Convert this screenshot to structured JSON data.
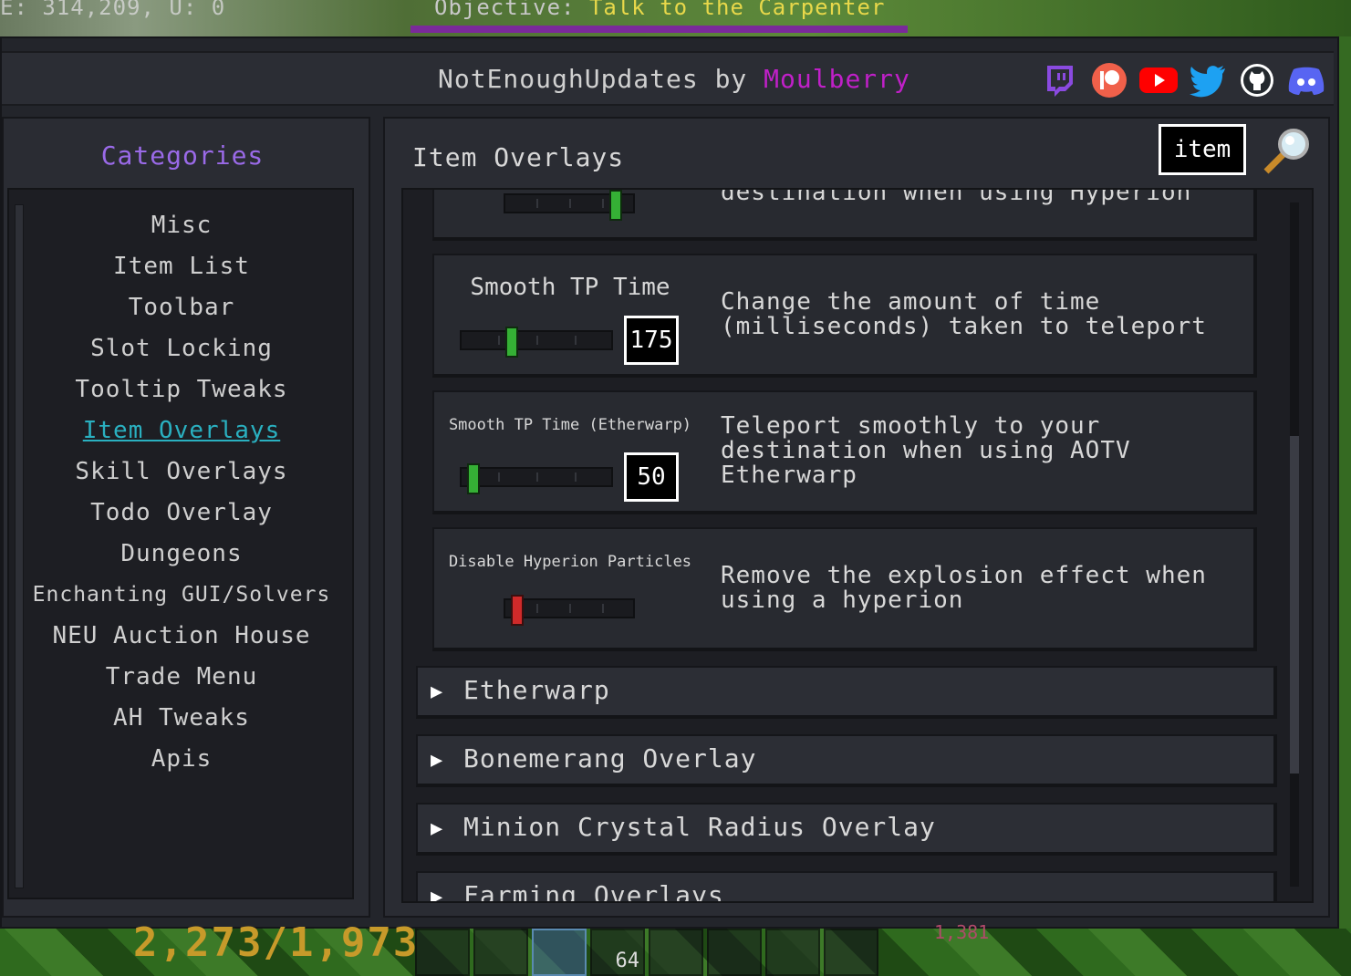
{
  "hud": {
    "coords": "E: 314,209, U: 0",
    "objective_label": "Objective:",
    "objective_value": "Talk to the Carpenter",
    "xp_text": "2,273/1,973",
    "other_text": "1,381",
    "hotbar_count": "64"
  },
  "window": {
    "title_prefix": "NotEnoughUpdates by ",
    "title_author": "Moulberry",
    "socials": [
      "twitch-icon",
      "patreon-icon",
      "youtube-icon",
      "twitter-icon",
      "github-icon",
      "discord-icon"
    ]
  },
  "sidebar": {
    "header": "Categories",
    "items": [
      {
        "label": "Misc"
      },
      {
        "label": "Item List"
      },
      {
        "label": "Toolbar"
      },
      {
        "label": "Slot Locking"
      },
      {
        "label": "Tooltip Tweaks"
      },
      {
        "label": "Item Overlays"
      },
      {
        "label": "Skill Overlays"
      },
      {
        "label": "Todo Overlay"
      },
      {
        "label": "Dungeons"
      },
      {
        "label": "Enchanting GUI/Solvers"
      },
      {
        "label": "NEU Auction House"
      },
      {
        "label": "Trade Menu"
      },
      {
        "label": "AH Tweaks"
      },
      {
        "label": "Apis"
      }
    ],
    "active_item": "Item Overlays"
  },
  "main": {
    "section_title": "Item Overlays",
    "search_value": "item",
    "cut_desc": "destination when using Hyperion",
    "options": [
      {
        "name": "Smooth TP Time",
        "value": "175",
        "description": "Change the amount of time\n(milliseconds) taken to teleport"
      },
      {
        "name": "Smooth TP Time (Etherwarp)",
        "value": "50",
        "description": "Teleport smoothly to your\ndestination when using AOTV\nEtherwarp"
      },
      {
        "name": "Disable Hyperion Particles",
        "toggle": false,
        "description": "Remove the explosion effect when\nusing a hyperion"
      }
    ],
    "accordions": [
      {
        "label": "Etherwarp"
      },
      {
        "label": "Bonemerang Overlay"
      },
      {
        "label": "Minion Crystal Radius Overlay"
      },
      {
        "label": "Farming Overlays"
      }
    ]
  },
  "colors": {
    "author": "#c020c8",
    "categories_header": "#9a6ae8",
    "active_category": "#2ab0c0",
    "slider_on": "#35b035",
    "toggle_off": "#d02a2a"
  }
}
